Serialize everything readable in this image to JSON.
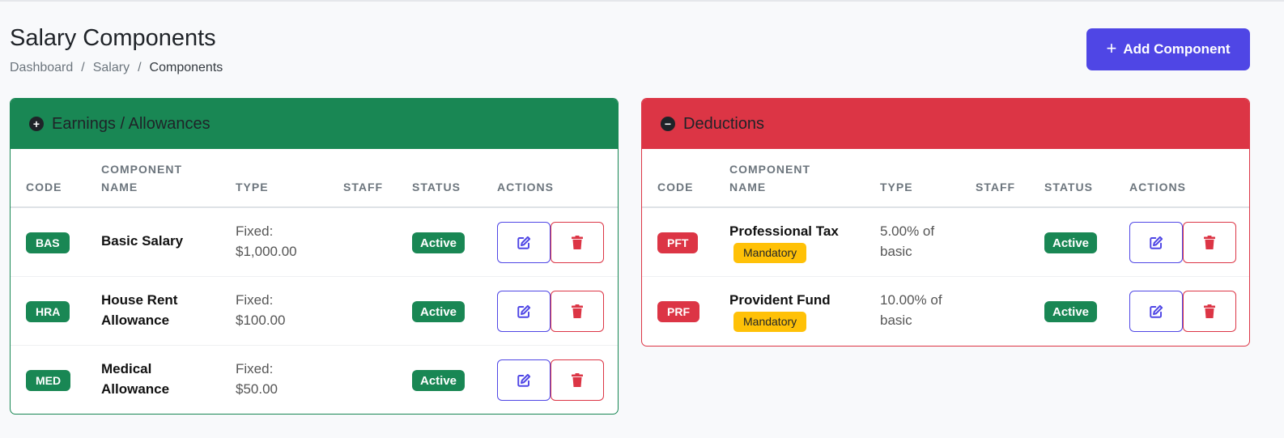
{
  "page": {
    "title": "Salary Components",
    "breadcrumb": [
      "Dashboard",
      "Salary",
      "Components"
    ],
    "breadcrumb_sep": "/",
    "add_button": {
      "icon": "plus-icon",
      "label": "Add Component"
    }
  },
  "colors": {
    "accent": "#4f46e5",
    "success": "#198754",
    "danger": "#dc3545",
    "warning": "#ffc107"
  },
  "columns": {
    "code": "CODE",
    "name_line1": "COMPONENT",
    "name_line2": "NAME",
    "type": "TYPE",
    "staff": "STAFF",
    "status": "STATUS",
    "actions": "ACTIONS"
  },
  "earnings": {
    "title": "Earnings / Allowances",
    "icon": "plus-circle-icon",
    "rows": [
      {
        "code": "BAS",
        "name1": "Basic Salary",
        "name2": "",
        "type1": "Fixed:",
        "type2": "$1,000.00",
        "staff": "",
        "status": "Active"
      },
      {
        "code": "HRA",
        "name1": "House Rent",
        "name2": "Allowance",
        "type1": "Fixed:",
        "type2": "$100.00",
        "staff": "",
        "status": "Active"
      },
      {
        "code": "MED",
        "name1": "Medical",
        "name2": "Allowance",
        "type1": "Fixed:",
        "type2": "$50.00",
        "staff": "",
        "status": "Active"
      }
    ]
  },
  "deductions": {
    "title": "Deductions",
    "icon": "minus-circle-icon",
    "rows": [
      {
        "code": "PFT",
        "name1": "Professional Tax",
        "badge": "Mandatory",
        "type1": "5.00% of",
        "type2": "basic",
        "staff": "",
        "status": "Active"
      },
      {
        "code": "PRF",
        "name1": "Provident Fund",
        "badge": "Mandatory",
        "type1": "10.00% of",
        "type2": "basic",
        "staff": "",
        "status": "Active"
      }
    ]
  }
}
